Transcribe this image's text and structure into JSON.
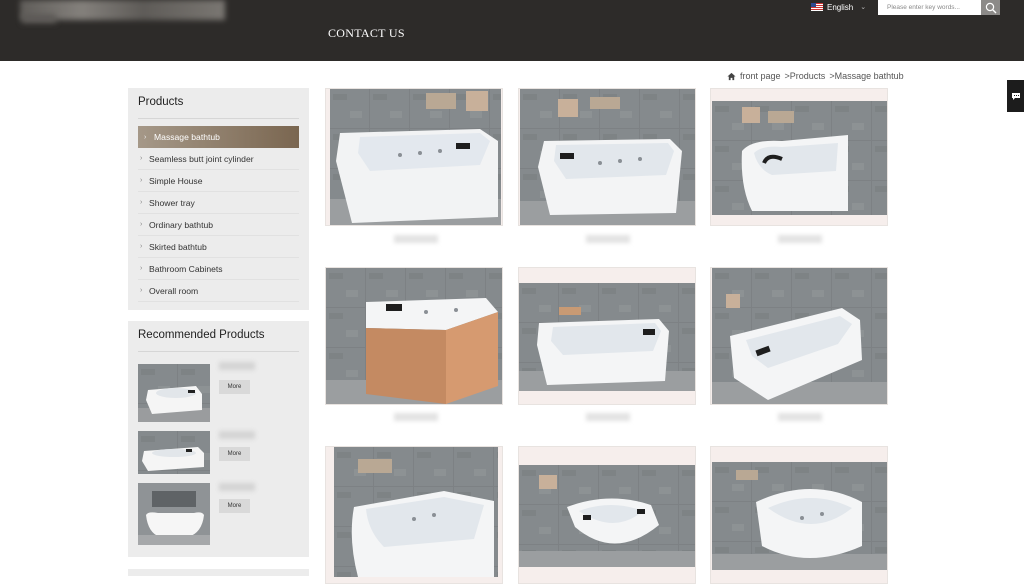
{
  "header": {
    "nav_contact": "CONTACT US",
    "language": "English",
    "search_placeholder": "Please enter key words..."
  },
  "breadcrumb": {
    "home": "front page",
    "products": ">Products",
    "current": ">Massage bathtub"
  },
  "sidebar": {
    "products_title": "Products",
    "categories": [
      "Massage bathtub",
      "Seamless butt joint cylinder",
      "Simple House",
      "Shower tray",
      "Ordinary bathtub",
      "Skirted bathtub",
      "Bathroom Cabinets",
      "Overall room"
    ],
    "active_category": "Massage bathtub",
    "recommended_title": "Recommended Products",
    "more_label": "More"
  },
  "colors": {
    "header_bg": "#2d2b29",
    "active_item": "#8a7763",
    "panel_bg": "#ececec",
    "card_bg": "#f6eeec"
  }
}
